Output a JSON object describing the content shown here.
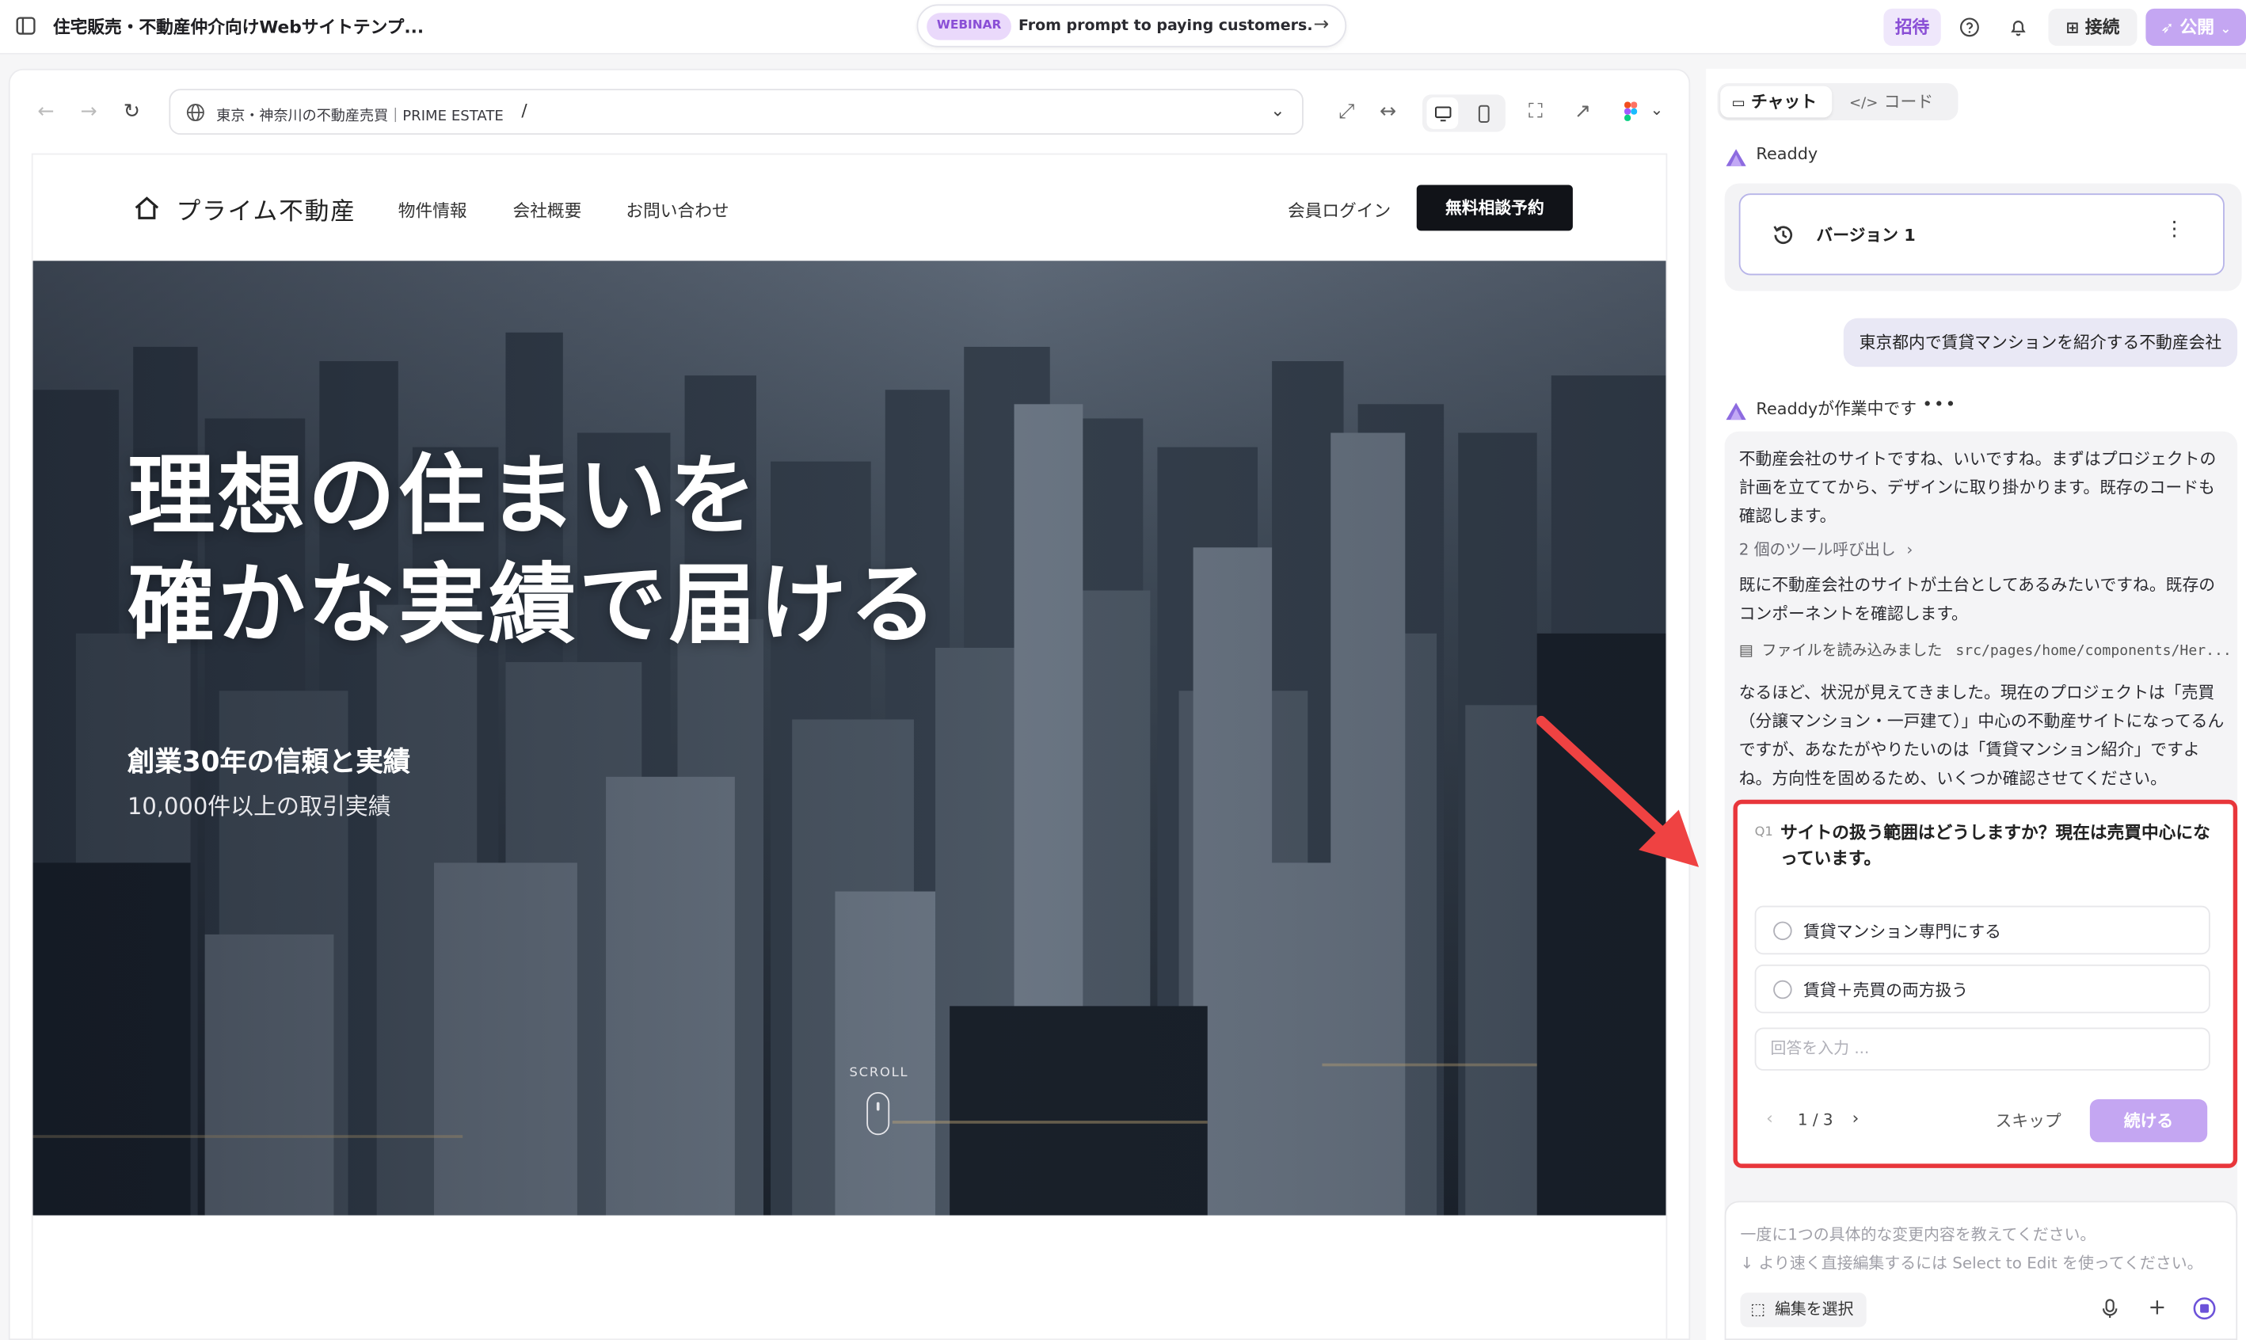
{
  "topbar": {
    "project_title": "住宅販売・不動産仲介向けWebサイトテンプ...",
    "webinar_badge": "WEBINAR",
    "webinar_text": "From prompt to paying customers.",
    "invite_label": "招待",
    "connect_label": "接続",
    "publish_label": "公開"
  },
  "browser": {
    "site_title": "東京・神奈川の不動産売買｜PRIME ESTATE",
    "path": "/"
  },
  "site": {
    "logo": "プライム不動産",
    "nav": [
      "物件情報",
      "会社概要",
      "お問い合わせ"
    ],
    "login": "会員ログイン",
    "cta": "無料相談予約",
    "hero_line1": "理想の住まいを",
    "hero_line2": "確かな実績で届ける",
    "hero_sub1": "創業30年の信頼と実績",
    "hero_sub2": "10,000件以上の取引実績",
    "scroll": "SCROLL"
  },
  "chat": {
    "tab_chat": "チャット",
    "tab_code": "コード",
    "assistant_name": "Readdy",
    "version_label": "バージョン 1",
    "user_message": "東京都内で賃貸マンションを紹介する不動産会社",
    "working_label": "Readdyが作業中です",
    "ai_p1": "不動産会社のサイトですね、いいですね。まずはプロジェクトの計画を立ててから、デザインに取り掛かります。既存のコードも確認します。",
    "tool_calls": "2 個のツール呼び出し",
    "ai_p2": "既に不動産会社のサイトが土台としてあるみたいですね。既存のコンポーネントを確認します。",
    "file_read_label": "ファイルを読み込みました",
    "file_read_path": "src/pages/home/components/Her...",
    "ai_p3": "なるほど、状況が見えてきました。現在のプロジェクトは「売買（分譲マンション・一戸建て）」中心の不動産サイトになってるんですが、あなたがやりたいのは「賃貸マンション紹介」ですよね。方向性を固めるため、いくつか確認させてください。",
    "question": {
      "num": "Q1",
      "title": "サイトの扱う範囲はどうしますか？現在は売買中心になっています。",
      "options": [
        "賃貸マンション専門にする",
        "賃貸＋売買の両方扱う"
      ],
      "input_placeholder": "回答を入力 ...",
      "pager": "1 / 3",
      "skip": "スキップ",
      "continue": "続ける"
    },
    "composer_ph1": "一度に1つの具体的な変更内容を教えてください。",
    "composer_ph2": "↓ より速く直接編集するには Select to Edit を使ってください。",
    "select_edit": "編集を選択"
  },
  "colors": {
    "accent": "#8a4fd6",
    "accent_light": "#c4a6f2",
    "highlight": "#e8363b",
    "dark_button": "#111318"
  }
}
